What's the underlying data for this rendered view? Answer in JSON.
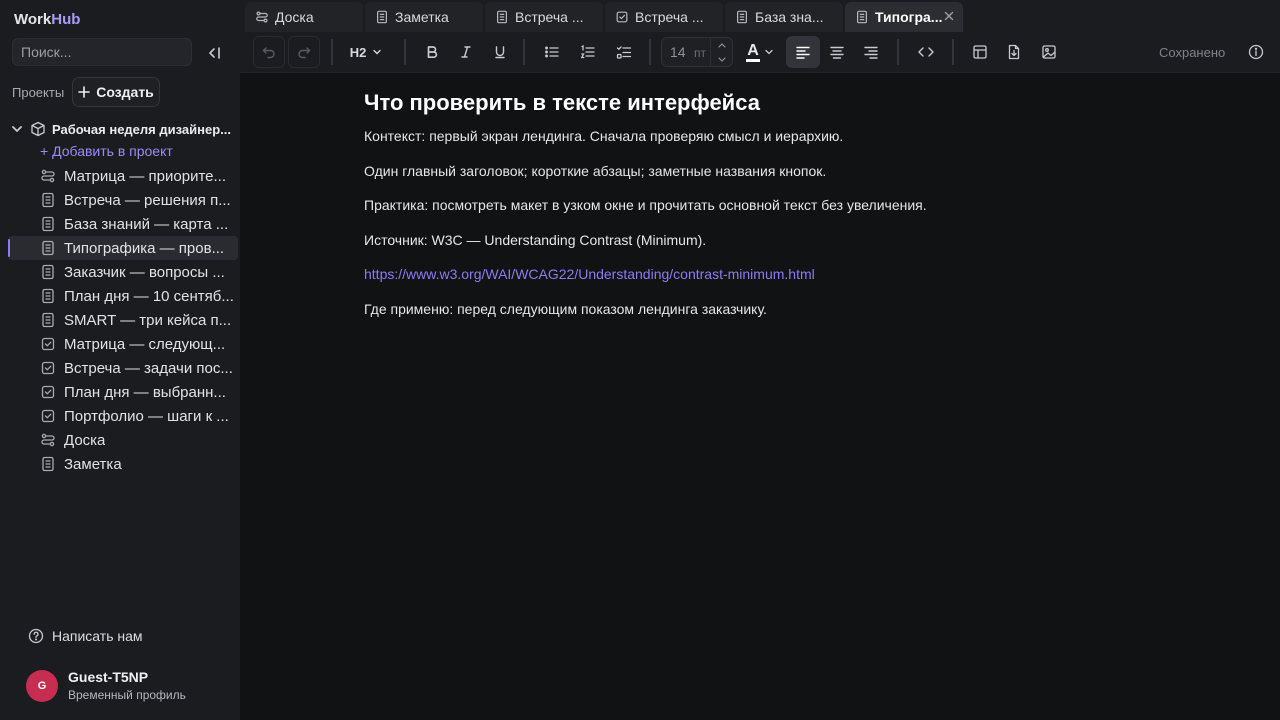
{
  "app": {
    "logo_main": "Work",
    "logo_accent": "Hub"
  },
  "sidebar": {
    "search_placeholder": "Поиск...",
    "projects_label": "Проекты",
    "create_label": "Создать",
    "project_name": "Рабочая неделя дизайнер...",
    "add_to_project": "+ Добавить в проект",
    "items": [
      {
        "label": "Матрица — приорите...",
        "icon": "board-icon"
      },
      {
        "label": "Встреча — решения п...",
        "icon": "note-icon"
      },
      {
        "label": "База знаний — карта ...",
        "icon": "note-icon"
      },
      {
        "label": "Типографика — пров...",
        "icon": "note-icon",
        "active": true
      },
      {
        "label": "Заказчик — вопросы ...",
        "icon": "note-icon"
      },
      {
        "label": "План дня — 10 сентяб...",
        "icon": "note-icon"
      },
      {
        "label": "SMART — три кейса п...",
        "icon": "note-icon"
      },
      {
        "label": "Матрица — следующ...",
        "icon": "task-icon"
      },
      {
        "label": "Встреча — задачи пос...",
        "icon": "task-icon"
      },
      {
        "label": "План дня — выбранн...",
        "icon": "task-icon"
      },
      {
        "label": "Портфолио — шаги к ...",
        "icon": "task-icon"
      },
      {
        "label": "Доска",
        "icon": "board-icon"
      },
      {
        "label": "Заметка",
        "icon": "note-icon"
      }
    ],
    "help_label": "Написать нам",
    "user": {
      "initial": "G",
      "name": "Guest-T5NP",
      "subtitle": "Временный профиль"
    }
  },
  "tabs": [
    {
      "label": "Доска",
      "icon": "board-icon"
    },
    {
      "label": "Заметка",
      "icon": "note-icon"
    },
    {
      "label": "Встреча ...",
      "icon": "note-icon"
    },
    {
      "label": "Встреча ...",
      "icon": "task-icon"
    },
    {
      "label": "База зна...",
      "icon": "note-icon"
    },
    {
      "label": "Типогра...",
      "icon": "note-icon",
      "active": true
    }
  ],
  "toolbar": {
    "heading_level": "H2",
    "font_size": "14",
    "font_unit": "пт",
    "color_letter": "A",
    "saved_status": "Сохранено",
    "active_align": "left"
  },
  "document": {
    "title": "Что проверить в тексте интерфейса",
    "paragraphs": [
      "Контекст: первый экран лендинга. Сначала проверяю смысл и иерархию.",
      "Один главный заголовок; короткие абзацы; заметные названия кнопок.",
      "Практика: посмотреть макет в узком окне и прочитать основной текст без увеличения.",
      "Источник: W3C — Understanding Contrast (Minimum)."
    ],
    "link": "https://www.w3.org/WAI/WCAG22/Understanding/contrast-minimum.html",
    "closing": "Где применю: перед следующим показом лендинга заказчику."
  },
  "colors": {
    "accent": "#8e7cf0",
    "avatar": "#c62d50",
    "background": "#111214",
    "sidebar": "#1b1c20"
  }
}
